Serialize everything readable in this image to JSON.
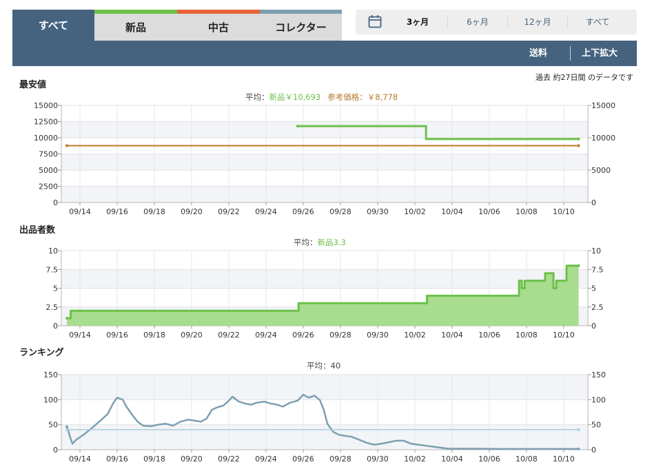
{
  "tabs": [
    {
      "label": "すべて",
      "stripe": "#45637f"
    },
    {
      "label": "新品",
      "stripe": "#6cc04a"
    },
    {
      "label": "中古",
      "stripe": "#e8633a"
    },
    {
      "label": "コレクター",
      "stripe": "#7c9fb0"
    }
  ],
  "range_options": [
    "3ヶ月",
    "6ヶ月",
    "12ヶ月",
    "すべて"
  ],
  "range_selected": "3ヶ月",
  "toolbar": {
    "shipping": "送料",
    "expand": "上下拡大"
  },
  "period_note": "過去 約27日間 のデータです",
  "colors": {
    "header": "#45637f",
    "new": "#6cc04a",
    "reference": "#b8782c",
    "ranking": "#7c9fb0",
    "ranking_avg": "#a9cbe0"
  },
  "x_ticks": [
    "09/14",
    "09/16",
    "09/18",
    "09/20",
    "09/22",
    "09/24",
    "09/26",
    "09/28",
    "09/30",
    "10/02",
    "10/04",
    "10/06",
    "10/08",
    "10/10"
  ],
  "chart_data": [
    {
      "title": "最安値",
      "type": "line",
      "avg_prefix": "平均：",
      "avg_new": "新品￥10,693",
      "avg_ref": "参考価格：￥8,778",
      "ylim": [
        0,
        15000
      ],
      "yticks_left": [
        0,
        2500,
        5000,
        7500,
        10000,
        12500,
        15000
      ],
      "yticks_right": [
        0,
        5000,
        10000,
        15000
      ],
      "series": [
        {
          "name": "新品",
          "values": [
            [
              25.7,
              11800
            ],
            [
              32.5,
              11800
            ],
            [
              32.6,
              9800
            ],
            [
              40.8,
              9800
            ]
          ]
        },
        {
          "name": "参考価格",
          "values": [
            [
              13.3,
              8778
            ],
            [
              40.8,
              8778
            ]
          ]
        }
      ]
    },
    {
      "title": "出品者数",
      "type": "area",
      "avg_prefix": "平均：",
      "avg_new": "新品3.3",
      "ylim": [
        0,
        10
      ],
      "yticks_left": [
        0,
        2.5,
        5,
        7.5,
        10
      ],
      "yticks_right": [
        0,
        2.5,
        5,
        7.5,
        10
      ],
      "series": [
        {
          "name": "新品",
          "values": [
            [
              13.3,
              1
            ],
            [
              13.5,
              2
            ],
            [
              25.7,
              2
            ],
            [
              25.75,
              3
            ],
            [
              32.6,
              3
            ],
            [
              32.65,
              4
            ],
            [
              37.5,
              4
            ],
            [
              37.6,
              6
            ],
            [
              37.75,
              5
            ],
            [
              37.9,
              6
            ],
            [
              38.9,
              6
            ],
            [
              39.0,
              7
            ],
            [
              39.3,
              7
            ],
            [
              39.45,
              5
            ],
            [
              39.6,
              6
            ],
            [
              40.1,
              6
            ],
            [
              40.15,
              8
            ],
            [
              40.8,
              8
            ]
          ]
        }
      ]
    },
    {
      "title": "ランキング",
      "type": "line",
      "avg_prefix": "平均：",
      "avg_value": "40",
      "ylim": [
        0,
        150
      ],
      "yticks_left": [
        0,
        50,
        100,
        150
      ],
      "yticks_right": [
        0,
        50,
        100,
        150
      ],
      "series": [
        {
          "name": "ランキング",
          "values": [
            [
              13.3,
              46
            ],
            [
              13.5,
              22
            ],
            [
              13.6,
              12
            ],
            [
              13.8,
              20
            ],
            [
              14.2,
              30
            ],
            [
              14.6,
              42
            ],
            [
              15.1,
              58
            ],
            [
              15.5,
              72
            ],
            [
              15.8,
              94
            ],
            [
              16.0,
              104
            ],
            [
              16.3,
              100
            ],
            [
              16.5,
              86
            ],
            [
              16.8,
              70
            ],
            [
              17.1,
              56
            ],
            [
              17.4,
              48
            ],
            [
              17.8,
              47
            ],
            [
              18.2,
              50
            ],
            [
              18.6,
              52
            ],
            [
              19.0,
              48
            ],
            [
              19.4,
              56
            ],
            [
              19.8,
              60
            ],
            [
              20.2,
              58
            ],
            [
              20.5,
              56
            ],
            [
              20.8,
              62
            ],
            [
              21.1,
              80
            ],
            [
              21.4,
              85
            ],
            [
              21.7,
              88
            ],
            [
              22.0,
              98
            ],
            [
              22.2,
              106
            ],
            [
              22.5,
              97
            ],
            [
              22.9,
              92
            ],
            [
              23.2,
              90
            ],
            [
              23.5,
              94
            ],
            [
              23.9,
              96
            ],
            [
              24.3,
              92
            ],
            [
              24.6,
              90
            ],
            [
              24.9,
              86
            ],
            [
              25.3,
              94
            ],
            [
              25.7,
              98
            ],
            [
              26.0,
              110
            ],
            [
              26.3,
              104
            ],
            [
              26.6,
              108
            ],
            [
              26.9,
              99
            ],
            [
              27.1,
              80
            ],
            [
              27.3,
              52
            ],
            [
              27.6,
              36
            ],
            [
              27.9,
              30
            ],
            [
              28.2,
              28
            ],
            [
              28.6,
              26
            ],
            [
              29.0,
              20
            ],
            [
              29.4,
              14
            ],
            [
              29.8,
              10
            ],
            [
              30.2,
              12
            ],
            [
              30.6,
              15
            ],
            [
              31.0,
              18
            ],
            [
              31.4,
              18
            ],
            [
              31.8,
              12
            ],
            [
              32.2,
              10
            ],
            [
              32.6,
              8
            ],
            [
              33.0,
              6
            ],
            [
              33.4,
              4
            ],
            [
              33.8,
              2
            ],
            [
              34.5,
              2
            ],
            [
              35.5,
              2
            ],
            [
              36.5,
              1.5
            ],
            [
              37.5,
              1.5
            ],
            [
              38.5,
              1.5
            ],
            [
              39.5,
              1.5
            ],
            [
              40.8,
              1.5
            ]
          ]
        },
        {
          "name": "平均",
          "values": [
            [
              13.3,
              40
            ],
            [
              40.8,
              40
            ]
          ]
        }
      ]
    }
  ]
}
